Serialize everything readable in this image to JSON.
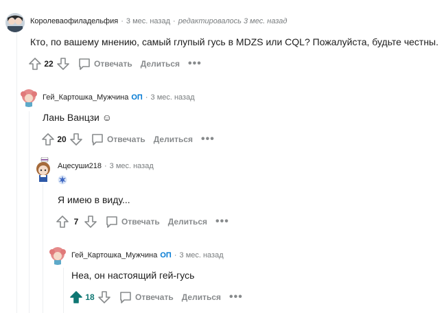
{
  "comments": [
    {
      "username": "Королеваофиладельфия",
      "time": "3 мес. назад",
      "edited": "редактировалось 3 мес. назад",
      "text": "Кто, по вашему мнению, самый глупый гусь в MDZS или CQL? Пожалуйста, будьте честны.",
      "score": "22",
      "reply_label": "Отвечать",
      "share_label": "Делиться",
      "more": "•••"
    },
    {
      "username": "Гей_Картошка_Мужчина",
      "op": "ОП",
      "time": "3 мес. назад",
      "text": "Лань Ванцзи ☺",
      "score": "20",
      "reply_label": "Отвечать",
      "share_label": "Делиться",
      "more": "•••"
    },
    {
      "username": "Ацесуши218",
      "time": "3 мес. назад",
      "text": "Я имею в виду...",
      "score": "7",
      "reply_label": "Отвечать",
      "share_label": "Делиться",
      "more": "•••"
    },
    {
      "username": "Гей_Картошка_Мужчина",
      "op": "ОП",
      "time": "3 мес. назад",
      "text": "Неа, он настоящий гей-гусь",
      "score": "18",
      "upvoted": true,
      "reply_label": "Отвечать",
      "share_label": "Делиться",
      "more": "•••"
    }
  ],
  "colors": {
    "op": "#0079d3",
    "upvote": "#0f7773",
    "meta": "#787c7e",
    "action": "#878a8c"
  },
  "icons": [
    "upvote-icon",
    "downvote-icon",
    "reply-bubble-icon",
    "more-icon",
    "flair-icon"
  ]
}
